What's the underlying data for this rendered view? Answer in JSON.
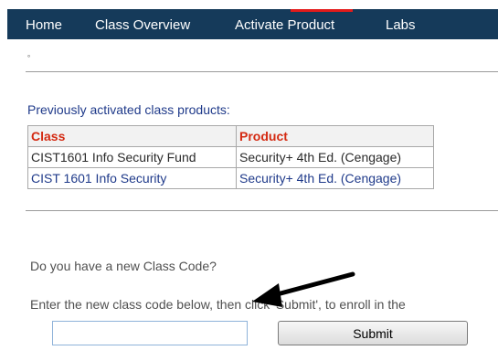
{
  "nav": {
    "items": [
      {
        "label": "Home"
      },
      {
        "label": "Class Overview"
      },
      {
        "label": "Activate Product"
      },
      {
        "label": "Labs"
      }
    ]
  },
  "small_mark": "˚",
  "previous": {
    "heading": "Previously activated class products:",
    "columns": [
      "Class",
      "Product"
    ],
    "rows": [
      {
        "class": "CIST1601 Info Security Fund",
        "product": "Security+ 4th Ed. (Cengage)"
      },
      {
        "class": "CIST 1601 Info Security",
        "product": "Security+ 4th Ed. (Cengage)"
      }
    ]
  },
  "enroll": {
    "question": "Do you have a new Class Code?",
    "instruction": "Enter the new class code below, then click 'Submit', to enroll in the",
    "code_value": "",
    "submit_label": "Submit"
  },
  "colors": {
    "nav_bg": "#153a5a",
    "nav_active": "#e31b1b",
    "heading_blue": "#1f3a8a",
    "column_header_red": "#d42a12"
  }
}
